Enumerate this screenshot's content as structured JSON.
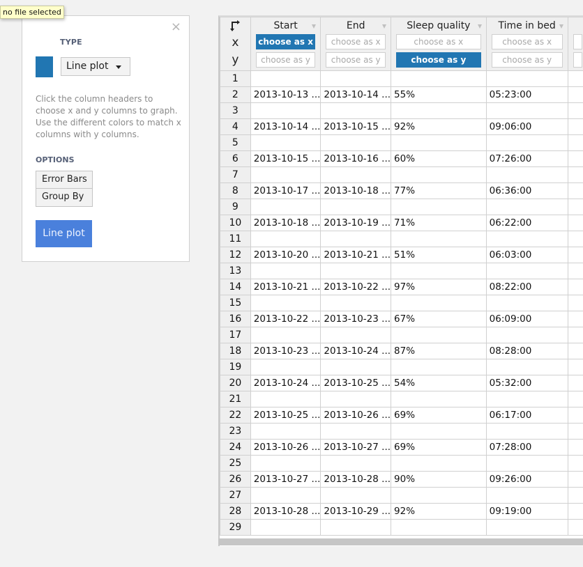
{
  "tooltip": "no file selected",
  "panel": {
    "type_label": "TYPE",
    "swatch_color": "#2176b2",
    "plot_type": "Line plot",
    "help_text": "Click the column headers to choose x and y columns to graph. Use the different colors to match x columns with y columns.",
    "options_label": "OPTIONS",
    "options": [
      "Error Bars",
      "Group By"
    ],
    "submit_label": "Line plot",
    "close_icon": "×"
  },
  "sheet": {
    "corner": {
      "x_label": "x",
      "y_label": "y"
    },
    "columns": [
      {
        "name": "Start",
        "x_label": "choose as x",
        "y_label": "choose as y",
        "x_selected": true,
        "y_selected": false
      },
      {
        "name": "End",
        "x_label": "choose as x",
        "y_label": "choose as y",
        "x_selected": false,
        "y_selected": false
      },
      {
        "name": "Sleep quality",
        "x_label": "choose as x",
        "y_label": "choose as y",
        "x_selected": false,
        "y_selected": true
      },
      {
        "name": "Time in bed",
        "x_label": "choose as x",
        "y_label": "choose as y",
        "x_selected": false,
        "y_selected": false
      },
      {
        "name": "",
        "x_label": "",
        "y_label": "",
        "x_selected": false,
        "y_selected": false
      }
    ],
    "rows": [
      {
        "n": "1",
        "cells": [
          "",
          "",
          "",
          "",
          ""
        ]
      },
      {
        "n": "2",
        "cells": [
          "2013-10-13 ...",
          "2013-10-14 ...",
          "55%",
          "05:23:00",
          ""
        ]
      },
      {
        "n": "3",
        "cells": [
          "",
          "",
          "",
          "",
          ""
        ]
      },
      {
        "n": "4",
        "cells": [
          "2013-10-14 ...",
          "2013-10-15 ...",
          "92%",
          "09:06:00",
          ""
        ]
      },
      {
        "n": "5",
        "cells": [
          "",
          "",
          "",
          "",
          ""
        ]
      },
      {
        "n": "6",
        "cells": [
          "2013-10-15 ...",
          "2013-10-16 ...",
          "60%",
          "07:26:00",
          ""
        ]
      },
      {
        "n": "7",
        "cells": [
          "",
          "",
          "",
          "",
          ""
        ]
      },
      {
        "n": "8",
        "cells": [
          "2013-10-17 ...",
          "2013-10-18 ...",
          "77%",
          "06:36:00",
          ""
        ]
      },
      {
        "n": "9",
        "cells": [
          "",
          "",
          "",
          "",
          ""
        ]
      },
      {
        "n": "10",
        "cells": [
          "2013-10-18 ...",
          "2013-10-19 ...",
          "71%",
          "06:22:00",
          ""
        ]
      },
      {
        "n": "11",
        "cells": [
          "",
          "",
          "",
          "",
          ""
        ]
      },
      {
        "n": "12",
        "cells": [
          "2013-10-20 ...",
          "2013-10-21 ...",
          "51%",
          "06:03:00",
          ""
        ]
      },
      {
        "n": "13",
        "cells": [
          "",
          "",
          "",
          "",
          ""
        ]
      },
      {
        "n": "14",
        "cells": [
          "2013-10-21 ...",
          "2013-10-22 ...",
          "97%",
          "08:22:00",
          ""
        ]
      },
      {
        "n": "15",
        "cells": [
          "",
          "",
          "",
          "",
          ""
        ]
      },
      {
        "n": "16",
        "cells": [
          "2013-10-22 ...",
          "2013-10-23 ...",
          "67%",
          "06:09:00",
          ""
        ]
      },
      {
        "n": "17",
        "cells": [
          "",
          "",
          "",
          "",
          ""
        ]
      },
      {
        "n": "18",
        "cells": [
          "2013-10-23 ...",
          "2013-10-24 ...",
          "87%",
          "08:28:00",
          ""
        ]
      },
      {
        "n": "19",
        "cells": [
          "",
          "",
          "",
          "",
          ""
        ]
      },
      {
        "n": "20",
        "cells": [
          "2013-10-24 ...",
          "2013-10-25 ...",
          "54%",
          "05:32:00",
          ""
        ]
      },
      {
        "n": "21",
        "cells": [
          "",
          "",
          "",
          "",
          ""
        ]
      },
      {
        "n": "22",
        "cells": [
          "2013-10-25 ...",
          "2013-10-26 ...",
          "69%",
          "06:17:00",
          ""
        ]
      },
      {
        "n": "23",
        "cells": [
          "",
          "",
          "",
          "",
          ""
        ]
      },
      {
        "n": "24",
        "cells": [
          "2013-10-26 ...",
          "2013-10-27 ...",
          "69%",
          "07:28:00",
          ""
        ]
      },
      {
        "n": "25",
        "cells": [
          "",
          "",
          "",
          "",
          ""
        ]
      },
      {
        "n": "26",
        "cells": [
          "2013-10-27 ...",
          "2013-10-28 ...",
          "90%",
          "09:26:00",
          ""
        ]
      },
      {
        "n": "27",
        "cells": [
          "",
          "",
          "",
          "",
          ""
        ]
      },
      {
        "n": "28",
        "cells": [
          "2013-10-28 ...",
          "2013-10-29 ...",
          "92%",
          "09:19:00",
          ""
        ]
      },
      {
        "n": "29",
        "cells": [
          "",
          "",
          "",
          "",
          ""
        ]
      }
    ]
  }
}
